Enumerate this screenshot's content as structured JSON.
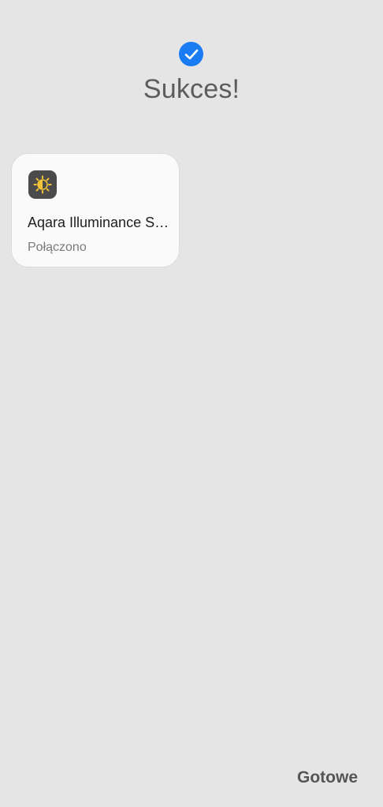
{
  "header": {
    "title": "Sukces!",
    "status_icon": "check-circle-icon",
    "accent_color": "#1a7cf2"
  },
  "device_card": {
    "name": "Aqara Illuminance Sensor",
    "status": "Połączono",
    "icon": "sun-icon",
    "icon_color": "#f3c43a",
    "icon_bg": "#4b4b4b"
  },
  "footer": {
    "done_label": "Gotowe"
  }
}
